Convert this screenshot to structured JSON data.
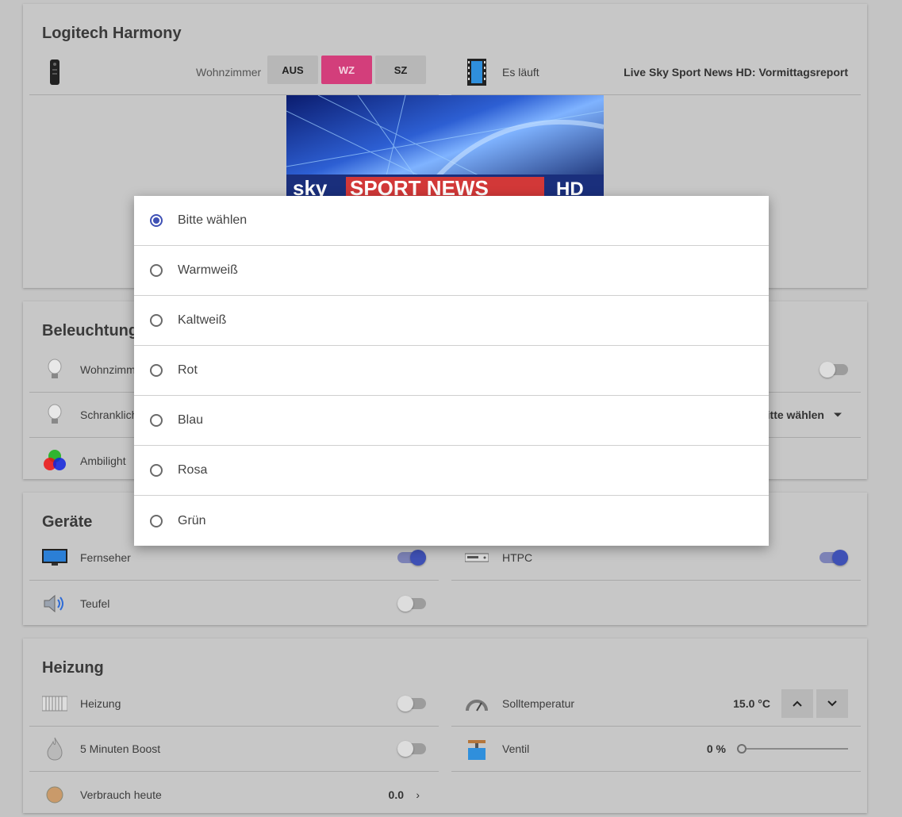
{
  "harmony": {
    "title": "Logitech Harmony",
    "room_label": "Wohnzimmer",
    "buttons": [
      "AUS",
      "WZ",
      "SZ"
    ],
    "active_button": "WZ",
    "playing_label": "Es läuft",
    "playing_value": "Live Sky Sport News HD: Vormittagsreport",
    "thumbnail_text": [
      "sky",
      "SPORT NEWS",
      "HD"
    ]
  },
  "lighting": {
    "title": "Beleuchtung",
    "rows": [
      {
        "label": "Wohnzimmer",
        "icon": "bulb-icon"
      },
      {
        "label": "Schranklicht",
        "icon": "bulb-icon"
      },
      {
        "label": "Ambilight",
        "icon": "rgb-icon"
      }
    ],
    "right_select_value": "Bitte wählen",
    "right_toggle_on": false
  },
  "devices": {
    "title": "Geräte",
    "rows": [
      {
        "label": "Fernseher",
        "icon": "tv-icon",
        "on": true
      },
      {
        "label": "Teufel",
        "icon": "speaker-icon",
        "on": false
      },
      {
        "label": "HTPC",
        "icon": "htpc-icon",
        "on": true
      }
    ]
  },
  "heating": {
    "title": "Heizung",
    "heizung_label": "Heizung",
    "boost_label": "5 Minuten Boost",
    "verbrauch_label": "Verbrauch heute",
    "verbrauch_value": "0.0",
    "soll_label": "Solltemperatur",
    "soll_value": "15.0 °C",
    "ventil_label": "Ventil",
    "ventil_value": "0 %",
    "ventil_level": 0
  },
  "dropdown": {
    "options": [
      "Bitte wählen",
      "Warmweiß",
      "Kaltweiß",
      "Rot",
      "Blau",
      "Rosa",
      "Grün"
    ],
    "selected": "Bitte wählen"
  },
  "colors": {
    "accent": "#3f51b5",
    "pink": "#d33e7b",
    "overlay_bg": "#c4c4c4"
  }
}
